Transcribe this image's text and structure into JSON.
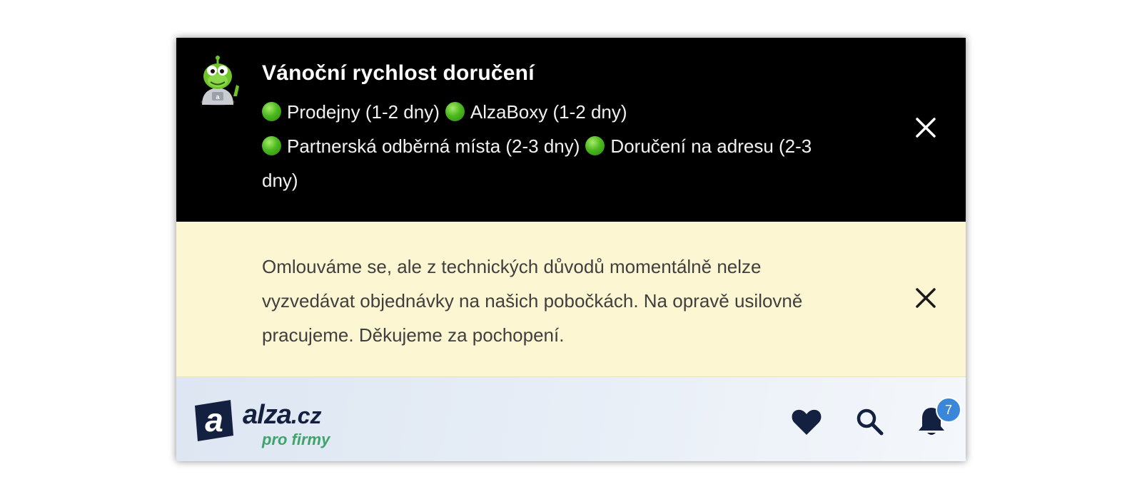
{
  "promo": {
    "title": "Vánoční rychlost doručení",
    "items": [
      "Prodejny (1-2 dny)",
      "AlzaBoxy (1-2 dny)",
      "Partnerská odběrná místa (2-3 dny)",
      "Doručení na adresu (2-3 dny)"
    ],
    "status_color": "#4cb91e",
    "background": "#000000",
    "close_icon": "close-icon"
  },
  "notice": {
    "text": "Omlouváme se, ale z technických důvodů momentálně nelze vyzvedávat objednávky na našich pobočkách. Na opravě usilovně pracujeme. Děkujeme za pochopení.",
    "background": "#fdf6d2",
    "close_icon": "close-icon"
  },
  "header": {
    "logo": {
      "brand": "alza",
      "tld": ".cz",
      "subtitle": "pro firmy"
    },
    "icons": [
      "heart-icon",
      "search-icon",
      "bell-icon"
    ],
    "notifications_count": "7",
    "accent_color": "#13203f",
    "badge_color": "#3a87d9"
  }
}
